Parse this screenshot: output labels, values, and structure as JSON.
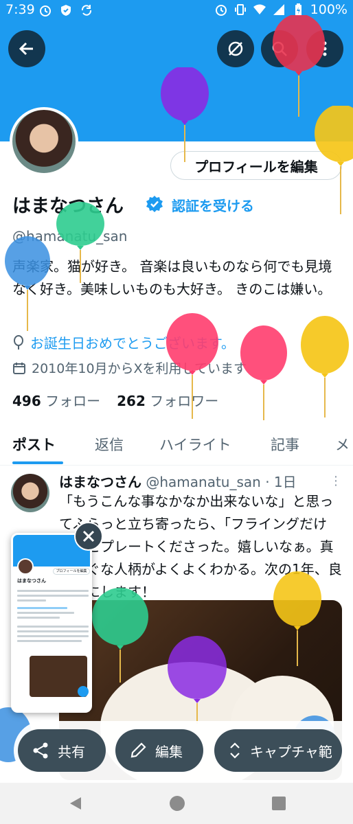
{
  "status_bar": {
    "time": "7:39",
    "battery": "100%"
  },
  "profile": {
    "name": "はまなつさん",
    "verify_label": "認証を受ける",
    "handle": "@hamanatu_san",
    "bio": "声楽家。猫が好き。 音楽は良いものなら何でも見境なく好き。美味しいものも大好き。 きのこは嫌い。",
    "birthday": "お誕生日おめでとうございます。",
    "joined": "2010年10月からXを利用しています",
    "following_count": "496",
    "following_label": "フォロー",
    "followers_count": "262",
    "followers_label": "フォロワー",
    "edit_button": "プロフィールを編集"
  },
  "tabs": [
    "ポスト",
    "返信",
    "ハイライト",
    "記事",
    "メ"
  ],
  "post": {
    "name": "はまなつさん",
    "handle_time": "@hamanatu_san · 1日",
    "text": "「もうこんな事なかなか出来ないな」と思ってふらっと立ち寄ったら、「フライングだけど」とプレートくださった。嬉しいなぁ。真っすぐな人柄がよくよくわかる。次の1年、良い年にします！"
  },
  "thumbnail": {
    "edit": "プロフィールを編集",
    "name": "はまなつさん"
  },
  "actions": {
    "share": "共有",
    "edit": "編集",
    "capture": "キャプチャ範"
  },
  "colors": {
    "accent": "#1d9bf0",
    "pill": "#3c4e59"
  }
}
